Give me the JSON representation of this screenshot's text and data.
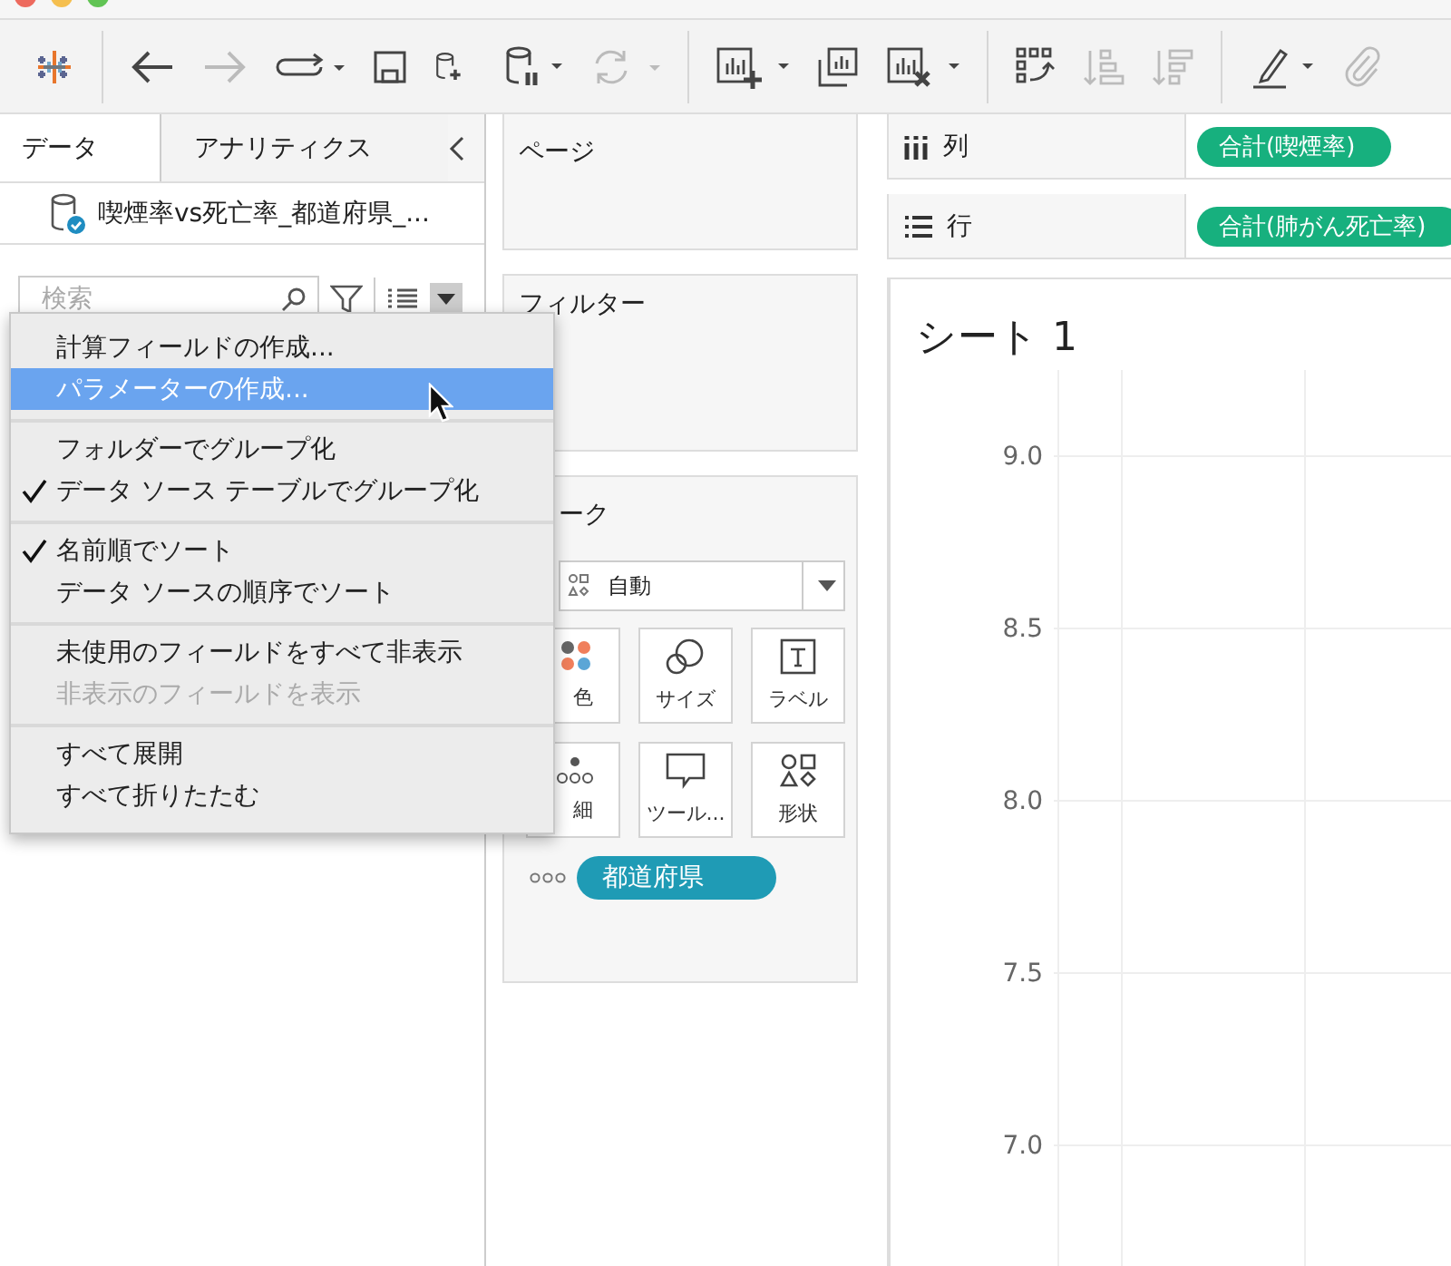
{
  "toolbar": [
    {
      "kind": "logo"
    },
    {
      "kind": "back",
      "disabled": false
    },
    {
      "kind": "forward",
      "disabled": true
    },
    {
      "kind": "redo-flow",
      "disabled": false
    },
    {
      "kind": "save",
      "disabled": false
    },
    {
      "kind": "add-datasource",
      "disabled": false
    },
    {
      "kind": "pause-datasource",
      "disabled": false
    },
    {
      "kind": "refresh",
      "disabled": true
    },
    {
      "kind": "new-sheet",
      "disabled": false
    },
    {
      "kind": "duplicate-sheet",
      "disabled": false
    },
    {
      "kind": "clear-sheet",
      "disabled": false
    },
    {
      "kind": "swap",
      "disabled": false
    },
    {
      "kind": "sort-asc",
      "disabled": true
    },
    {
      "kind": "sort-desc",
      "disabled": true
    },
    {
      "kind": "highlight",
      "disabled": false
    },
    {
      "kind": "attach",
      "disabled": true
    }
  ],
  "data_pane": {
    "tabs": [
      {
        "label": "データ",
        "selected": true
      },
      {
        "label": "アナリティクス",
        "selected": false
      }
    ],
    "datasource": "喫煙率vs死亡率_都道府県_...",
    "search": {
      "placeholder": "検索"
    }
  },
  "menu": {
    "sections": [
      {
        "items": [
          {
            "label": "計算フィールドの作成...",
            "checked": false,
            "disabled": false,
            "selected": false
          },
          {
            "label": "パラメーターの作成...",
            "checked": false,
            "disabled": false,
            "selected": true
          }
        ]
      },
      {
        "items": [
          {
            "label": "フォルダーでグループ化",
            "checked": false,
            "disabled": false,
            "selected": false
          },
          {
            "label": "データ ソース テーブルでグループ化",
            "checked": true,
            "disabled": false,
            "selected": false
          }
        ]
      },
      {
        "items": [
          {
            "label": "名前順でソート",
            "checked": true,
            "disabled": false,
            "selected": false
          },
          {
            "label": "データ ソースの順序でソート",
            "checked": false,
            "disabled": false,
            "selected": false
          }
        ]
      },
      {
        "items": [
          {
            "label": "未使用のフィールドをすべて非表示",
            "checked": false,
            "disabled": false,
            "selected": false
          },
          {
            "label": "非表示のフィールドを表示",
            "checked": false,
            "disabled": true,
            "selected": false
          }
        ]
      },
      {
        "items": [
          {
            "label": "すべて展開",
            "checked": false,
            "disabled": false,
            "selected": false
          },
          {
            "label": "すべて折りたたむ",
            "checked": false,
            "disabled": false,
            "selected": false
          }
        ]
      }
    ]
  },
  "pages_card": {
    "title": "ページ"
  },
  "filters_card": {
    "title": "フィルター"
  },
  "marks_card": {
    "title": "ーク",
    "mark_type": "自動",
    "buttons": [
      {
        "kind": "color",
        "label": "色"
      },
      {
        "kind": "size",
        "label": "サイズ"
      },
      {
        "kind": "label",
        "label": "ラベル"
      },
      {
        "kind": "detail",
        "label": "細"
      },
      {
        "kind": "tooltip",
        "label": "ツール..."
      },
      {
        "kind": "shape",
        "label": "形状"
      }
    ],
    "pills": [
      {
        "kind": "detail",
        "label": "都道府県"
      }
    ]
  },
  "shelves": [
    {
      "kind": "columns",
      "label": "列",
      "pill": "合計(喫煙率)"
    },
    {
      "kind": "rows",
      "label": "行",
      "pill": "合計(肺がん死亡率)"
    }
  ],
  "sheet": {
    "title": "シート 1",
    "axis_tick_labels": [
      "9.0",
      "8.5",
      "8.0",
      "7.5",
      "7.0"
    ]
  }
}
